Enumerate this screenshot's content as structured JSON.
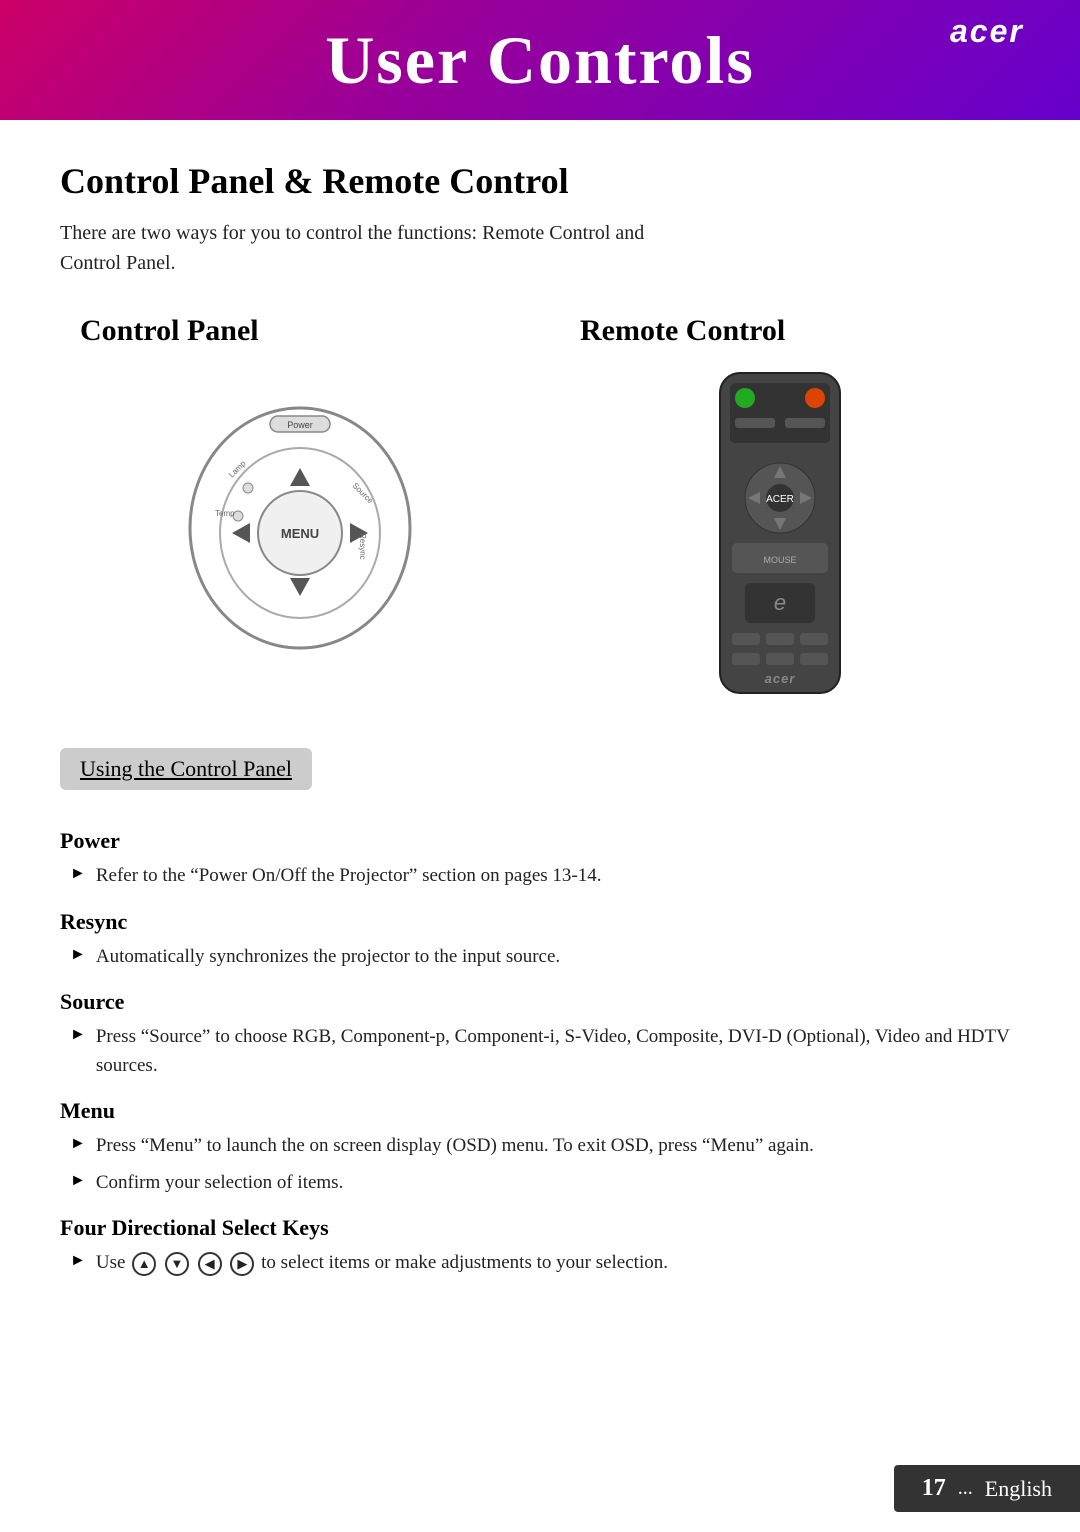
{
  "header": {
    "title": "User Controls",
    "logo": "acer"
  },
  "main": {
    "section_title": "Control Panel & Remote Control",
    "intro_text": "There are two ways for you to control the functions: Remote Control and Control Panel.",
    "panel_label": "Control Panel",
    "remote_label": "Remote Control",
    "subsection_header": "Using the Control Panel",
    "items": [
      {
        "title": "Power",
        "bullets": [
          "Refer to the “Power On/Off the Projector” section on pages 13-14."
        ]
      },
      {
        "title": "Resync",
        "bullets": [
          "Automatically synchronizes the projector to the input source."
        ]
      },
      {
        "title": "Source",
        "bullets": [
          "Press “Source” to choose RGB, Component-p, Component-i, S-Video, Composite, DVI-D (Optional), Video and HDTV sources."
        ]
      },
      {
        "title": "Menu",
        "bullets": [
          "Press “Menu” to launch the on screen display (OSD) menu. To exit OSD, press “Menu” again.",
          "Confirm your selection of items."
        ]
      },
      {
        "title": "Four Directional Select Keys",
        "bullets": [
          "Use ▲ ▼ ◄ ► to select items or make adjustments to your selection."
        ]
      }
    ]
  },
  "footer": {
    "page_number": "17",
    "dots": "...",
    "language": "English"
  }
}
